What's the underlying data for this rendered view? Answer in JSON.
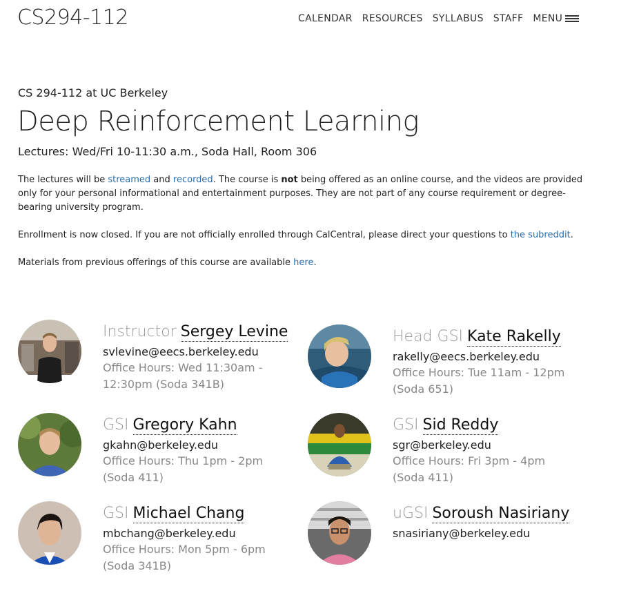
{
  "header": {
    "brand": "CS294-112",
    "nav": [
      {
        "label": "CALENDAR"
      },
      {
        "label": "RESOURCES"
      },
      {
        "label": "SYLLABUS"
      },
      {
        "label": "STAFF"
      },
      {
        "label": "MENU"
      }
    ]
  },
  "main": {
    "subtitle": "CS 294-112 at UC Berkeley",
    "title": "Deep Reinforcement Learning",
    "lectures": "Lectures: Wed/Fri 10-11:30 a.m., Soda Hall, Room 306",
    "para1": {
      "t1": "The lectures will be ",
      "link1": "streamed",
      "t2": " and ",
      "link2": "recorded",
      "t3": ". The course is ",
      "bold": "not",
      "t4": " being offered as an online course, and the videos are provided only for your personal informational and entertainment purposes. They are not part of any course requirement or degree-bearing university program."
    },
    "para2": {
      "t1": "Enrollment is now closed. If you are not officially enrolled through CalCentral, please direct your questions to ",
      "link": "the subreddit",
      "t2": "."
    },
    "para3": {
      "t1": "Materials from previous offerings of this course are available ",
      "link": "here",
      "t2": "."
    }
  },
  "staff": [
    {
      "role": "Instructor",
      "name": "Sergey Levine",
      "email": "svlevine@eecs.berkeley.edu",
      "hours": "Office Hours: Wed 11:30am - 12:30pm (Soda 341B)"
    },
    {
      "role": "Head GSI",
      "name": "Kate Rakelly",
      "email": "rakelly@eecs.berkeley.edu",
      "hours": "Office Hours: Tue 11am - 12pm (Soda 651)"
    },
    {
      "role": "GSI",
      "name": "Gregory Kahn",
      "email": "gkahn@berkeley.edu",
      "hours": "Office Hours: Thu 1pm - 2pm (Soda 411)"
    },
    {
      "role": "GSI",
      "name": "Sid Reddy",
      "email": "sgr@berkeley.edu",
      "hours": "Office Hours: Fri 3pm - 4pm (Soda 411)"
    },
    {
      "role": "GSI",
      "name": "Michael Chang",
      "email": "mbchang@berkeley.edu",
      "hours": "Office Hours: Mon 5pm - 6pm (Soda 341B)"
    },
    {
      "role": "uGSI",
      "name": "Soroush Nasiriany",
      "email": "snasiriany@berkeley.edu",
      "hours": ""
    }
  ]
}
